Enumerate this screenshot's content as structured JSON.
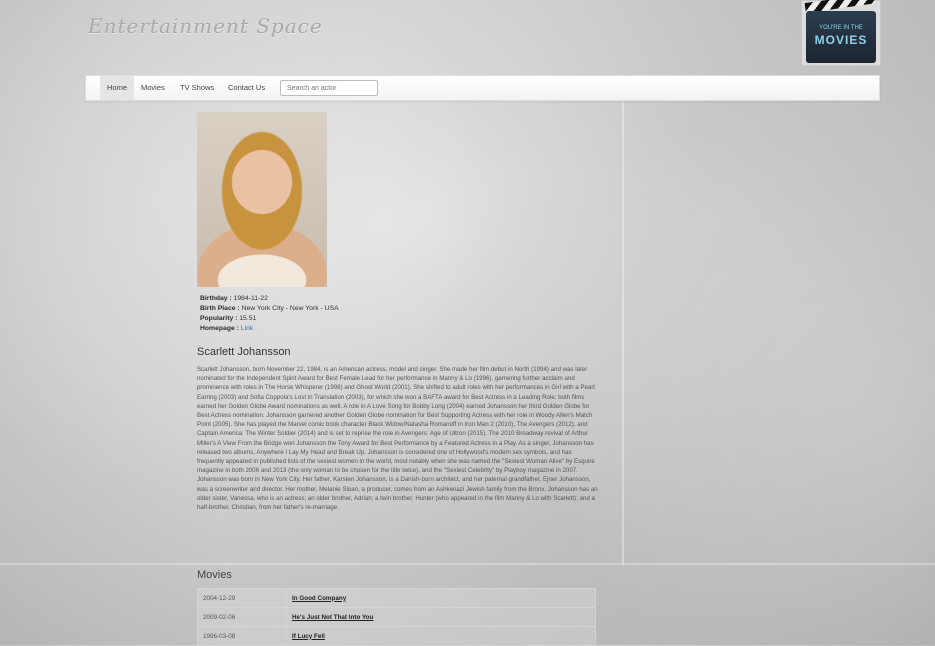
{
  "site": {
    "title": "Entertainment Space"
  },
  "logo": {
    "line1": "YOU'RE IN THE",
    "line2": "MOVIES"
  },
  "nav": {
    "items": [
      "Home",
      "Movies",
      "TV Shows",
      "Contact Us"
    ],
    "active": "Home",
    "search_placeholder": "Search an actor"
  },
  "actor": {
    "name": "Scarlett Johansson",
    "details": {
      "birthday_label": "Birthday :",
      "birthday": "1984-11-22",
      "birthplace_label": "Birth Place :",
      "birthplace": "New York City - New York - USA",
      "popularity_label": "Popularity :",
      "popularity": "15.51",
      "homepage_label": "Homepage :",
      "homepage": "Link"
    },
    "bio": "Scarlett Johansson, born November 22, 1984, is an American actress, model and singer. She made her film debut in North (1994) and was later nominated for the Independent Spirit Award for Best Female Lead for her performance in Manny & Lo (1996), garnering further acclaim and prominence with roles in The Horse Whisperer (1998) and Ghost World (2001). She shifted to adult roles with her performances in Girl with a Pearl Earring (2003) and Sofia Coppola's Lost in Translation (2003), for which she won a BAFTA award for Best Actress in a Leading Role; both films earned her Golden Globe Award nominations as well. A role in A Love Song for Bobby Long (2004) earned Johansson her third Golden Globe for Best Actress nomination. Johansson garnered another Golden Globe nomination for Best Supporting Actress with her role in Woody Allen's Match Point (2005). She has played the Marvel comic book character Black Widow/Natasha Romanoff in Iron Man 2 (2010), The Avengers (2012), and Captain America: The Winter Soldier (2014) and is set to reprise the role in Avengers: Age of Ultron (2015). The 2010 Broadway revival of Arthur Miller's A View From the Bridge won Johansson the Tony Award for Best Performance by a Featured Actress in a Play. As a singer, Johansson has released two albums, Anywhere I Lay My Head and Break Up. Johansson is considered one of Hollywood's modern sex symbols, and has frequently appeared in published lists of the sexiest women in the world, most notably when she was named the \"Sexiest Woman Alive\" by Esquire magazine in both 2006 and 2013 (the only woman to be chosen for the title twice), and the \"Sexiest Celebrity\" by Playboy magazine in 2007. Johansson was born in New York City. Her father, Karsten Johansson, is a Danish-born architect, and her paternal grandfather, Ejner Johansson, was a screenwriter and director. Her mother, Melanie Sloan, a producer, comes from an Ashkenazi Jewish family from the Bronx. Johansson has an older sister, Vanessa, who is an actress; an older brother, Adrian; a twin brother, Hunter (who appeared in the film Manny & Lo with Scarlett); and a half-brother, Christian, from her father's re-marriage."
  },
  "movies": {
    "heading": "Movies",
    "rows": [
      {
        "date": "2004-12-29",
        "title": "In Good Company"
      },
      {
        "date": "2009-02-06",
        "title": "He's Just Not That Into You"
      },
      {
        "date": "1996-03-08",
        "title": "If Lucy Fell"
      }
    ]
  }
}
